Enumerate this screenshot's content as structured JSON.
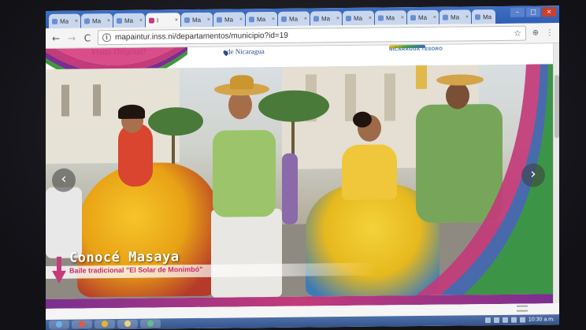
{
  "browser": {
    "tabs": [
      {
        "label": "Ma"
      },
      {
        "label": "Ma"
      },
      {
        "label": "Ma"
      },
      {
        "label": "I",
        "active": true
      },
      {
        "label": "Ma"
      },
      {
        "label": "Ma"
      },
      {
        "label": "Ma"
      },
      {
        "label": "Ma"
      },
      {
        "label": "Ma"
      },
      {
        "label": "Ma"
      },
      {
        "label": "Ma"
      },
      {
        "label": "Ma"
      },
      {
        "label": "Ma"
      },
      {
        "label": "Ma"
      }
    ],
    "tab_close_glyph": "×",
    "window_controls": {
      "minimize": "–",
      "maximize": "□",
      "close": "×"
    },
    "nav": {
      "back": "←",
      "forward": "→",
      "reload": "C"
    },
    "url": "mapaintur.inss.ni/departamentos/municipio?id=19",
    "info_icon": "i",
    "star_icon": "☆",
    "extension_icon": "⊕",
    "menu_icon": "⋮"
  },
  "site_header": {
    "logo_text": "Visita Original!",
    "center_text": "de Nicaragua",
    "right_text": "NICARAGUA TESORO"
  },
  "hero": {
    "title": "Conocé Masaya",
    "subtitle": "Baile tradicional \"El Solar de Monimbó\"",
    "prev_arrow": "‹",
    "next_arrow": "›"
  },
  "taskbar": {
    "clock": "10:30 a.m."
  },
  "colors": {
    "tabstrip": "#2f5fb3",
    "brand_magenta": "#c33b7a",
    "brand_purple": "#7a2f8f",
    "brand_green": "#3b9a3b",
    "brand_yellow": "#f0c000"
  }
}
